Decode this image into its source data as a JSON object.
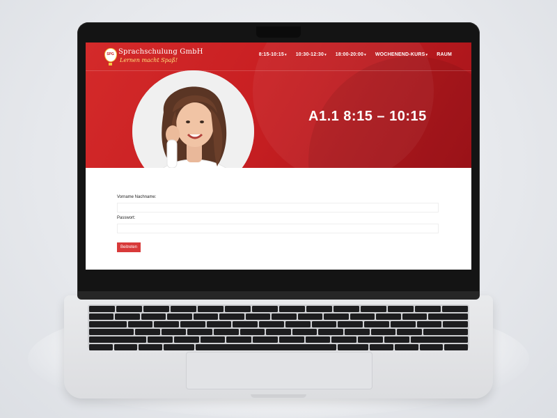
{
  "brand": {
    "name": "Sprachschulung GmbH",
    "tagline": "Lernen macht Spaß!",
    "badge": "SPG"
  },
  "nav": {
    "items": [
      {
        "label": "8:15-10:15",
        "has_dropdown": true
      },
      {
        "label": "10:30-12:30",
        "has_dropdown": true
      },
      {
        "label": "18:00-20:00",
        "has_dropdown": true
      },
      {
        "label": "WOCHENEND-KURS",
        "has_dropdown": true
      },
      {
        "label": "RAUM",
        "has_dropdown": false
      }
    ]
  },
  "hero": {
    "title": "A1.1 8:15 – 10:15"
  },
  "form": {
    "name_label": "Vorname Nachname:",
    "name_value": "",
    "password_label": "Passwort:",
    "password_value": "",
    "submit_label": "Beitreten"
  },
  "colors": {
    "accent": "#c81f22",
    "accent_dark": "#a5141a",
    "button": "#d83a3a",
    "logo_gold": "#f5c542"
  },
  "icons": {
    "dropdown": "caret-down-icon",
    "logo": "hot-air-balloon-icon"
  }
}
